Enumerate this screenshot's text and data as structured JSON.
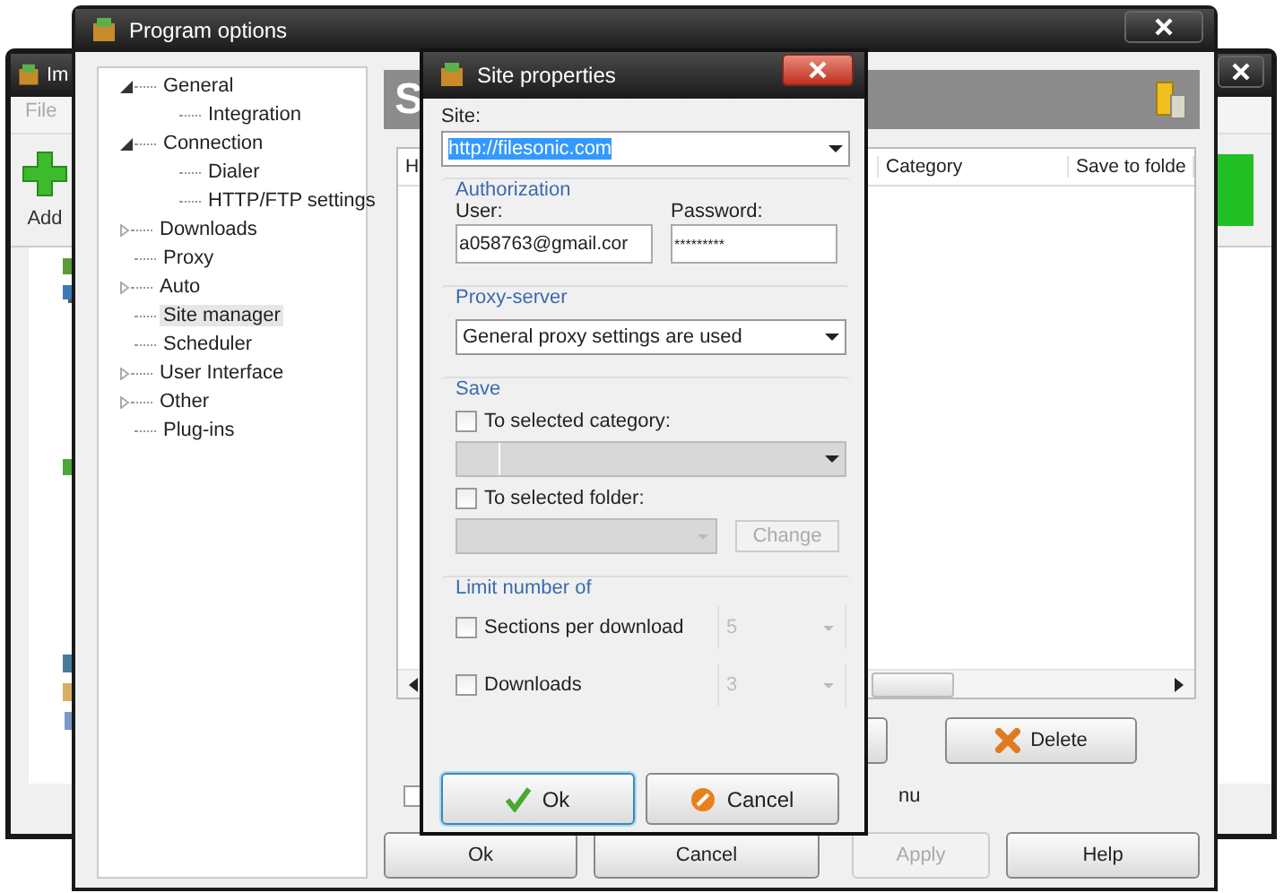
{
  "main_window": {
    "title": "Im",
    "menu": [
      "File"
    ],
    "toolbar": [
      {
        "label": "Add"
      }
    ]
  },
  "program_options": {
    "title": "Program options",
    "tree": [
      {
        "label": "General",
        "expanded": true,
        "selected": false,
        "children": [
          {
            "label": "Integration",
            "selected": false
          }
        ]
      },
      {
        "label": "Connection",
        "expanded": true,
        "selected": false,
        "children": [
          {
            "label": "Dialer",
            "selected": false
          },
          {
            "label": "HTTP/FTP settings",
            "selected": false
          }
        ]
      },
      {
        "label": "Downloads",
        "expanded": false,
        "selected": false
      },
      {
        "label": "Proxy",
        "selected": false
      },
      {
        "label": "Auto",
        "expanded": false,
        "selected": false
      },
      {
        "label": "Site manager",
        "selected": true
      },
      {
        "label": "Scheduler",
        "selected": false
      },
      {
        "label": "User Interface",
        "expanded": false,
        "selected": false
      },
      {
        "label": "Other",
        "expanded": false,
        "selected": false
      },
      {
        "label": "Plug-ins",
        "selected": false
      }
    ],
    "panel_title": "S",
    "table": {
      "columns": [
        "H",
        "Category",
        "Save to folde"
      ]
    },
    "delete_button": "Delete",
    "option_fragment": "nu",
    "option_checked": false,
    "buttons": [
      {
        "label": "Ok",
        "disabled": false
      },
      {
        "label": "Cancel",
        "disabled": false
      },
      {
        "label": "Apply",
        "disabled": true
      },
      {
        "label": "Help",
        "disabled": false
      }
    ]
  },
  "site_properties": {
    "title": "Site properties",
    "site_label": "Site:",
    "site_value": "http://filesonic.com",
    "authorization": {
      "title": "Authorization",
      "user_label": "User:",
      "user_value": "a058763@gmail.cor",
      "password_label": "Password:",
      "password_value": "*********"
    },
    "proxy": {
      "title": "Proxy-server",
      "value": "General proxy settings are used"
    },
    "save": {
      "title": "Save",
      "category_label": "To selected category:",
      "category_checked": false,
      "folder_label": "To selected folder:",
      "folder_checked": false,
      "change_button": "Change"
    },
    "limit": {
      "title": "Limit number of",
      "rows": [
        {
          "label": "Sections per download",
          "checked": false,
          "value": "5"
        },
        {
          "label": "Downloads",
          "checked": false,
          "value": "3"
        }
      ]
    },
    "buttons": [
      {
        "label": "Ok",
        "kind": "ok"
      },
      {
        "label": "Cancel",
        "kind": "cancel"
      }
    ]
  }
}
